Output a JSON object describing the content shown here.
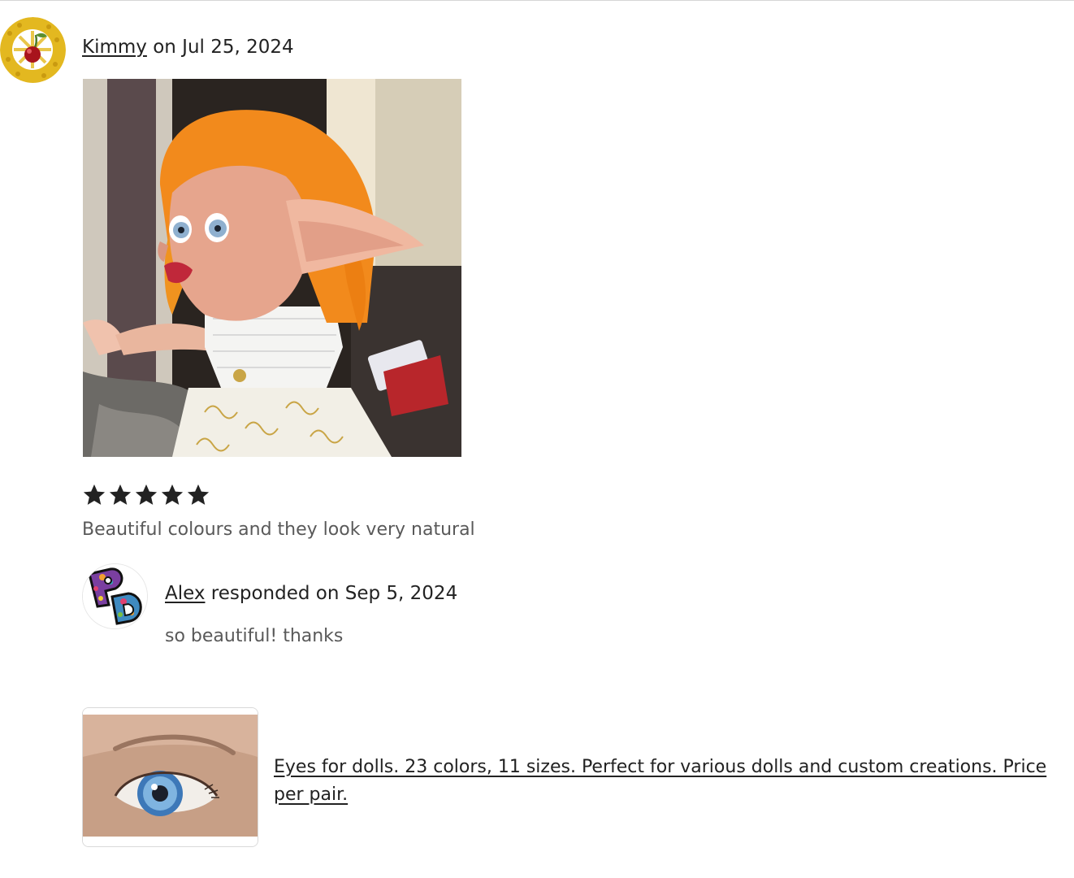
{
  "review": {
    "reviewer_name": "Kimmy",
    "date_text": "on Jul 25, 2024",
    "rating": 5,
    "rating_max": 5,
    "text": "Beautiful colours and they look very natural",
    "photo_icon": "doll-photo"
  },
  "response": {
    "seller_name": "Alex",
    "date_text": "responded on Sep 5, 2024",
    "text": "so beautiful! thanks"
  },
  "listing": {
    "title": "Eyes for dolls. 23 colors, 11 sizes. Perfect for various dolls and custom creations. Price per pair.",
    "thumbnail_icon": "doll-eye-photo"
  },
  "colors": {
    "text": "#222222",
    "muted_text": "#595959",
    "star": "#222222"
  }
}
